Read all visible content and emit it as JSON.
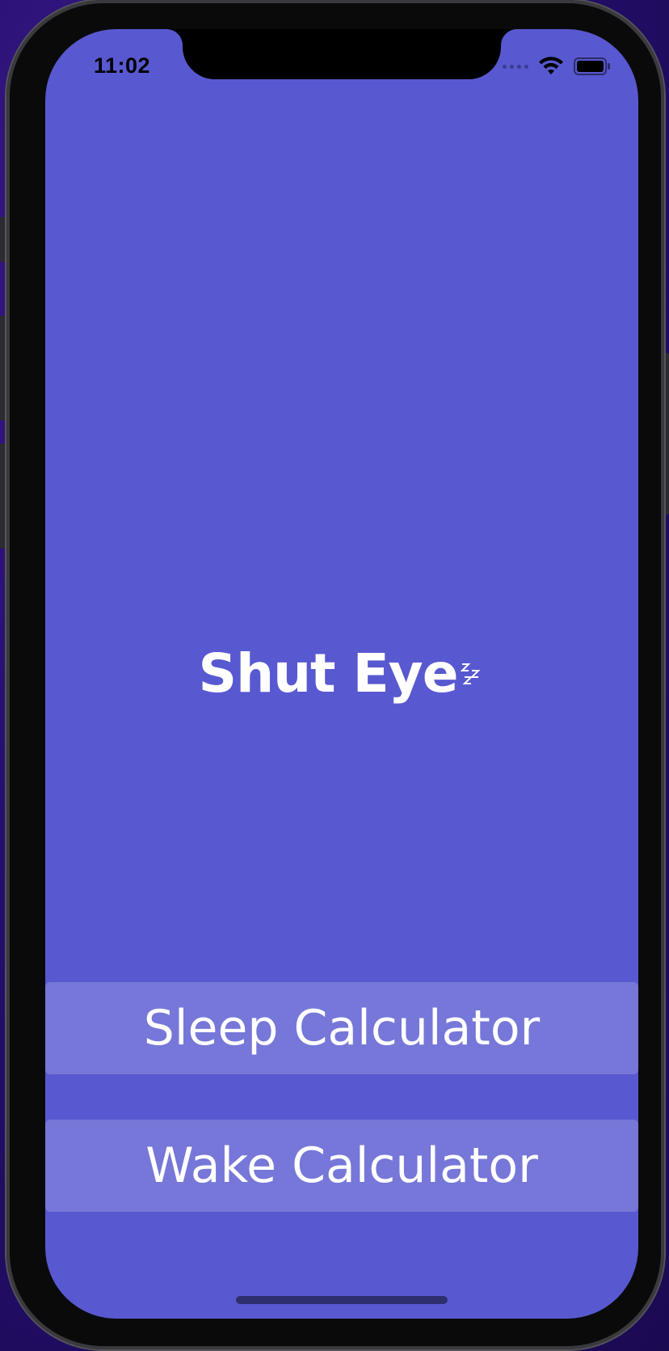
{
  "status_bar": {
    "time": "11:02",
    "icons": [
      "cellular-signal-icon",
      "wifi-icon",
      "battery-icon"
    ]
  },
  "app": {
    "title": "Shut Eye",
    "title_decoration": "zzz-icon"
  },
  "buttons": {
    "sleep_label": "Sleep Calculator",
    "wake_label": "Wake Calculator"
  },
  "colors": {
    "background": "#5859d0",
    "button_fill": "rgba(255,255,255,0.18)",
    "text": "#ffffff"
  }
}
